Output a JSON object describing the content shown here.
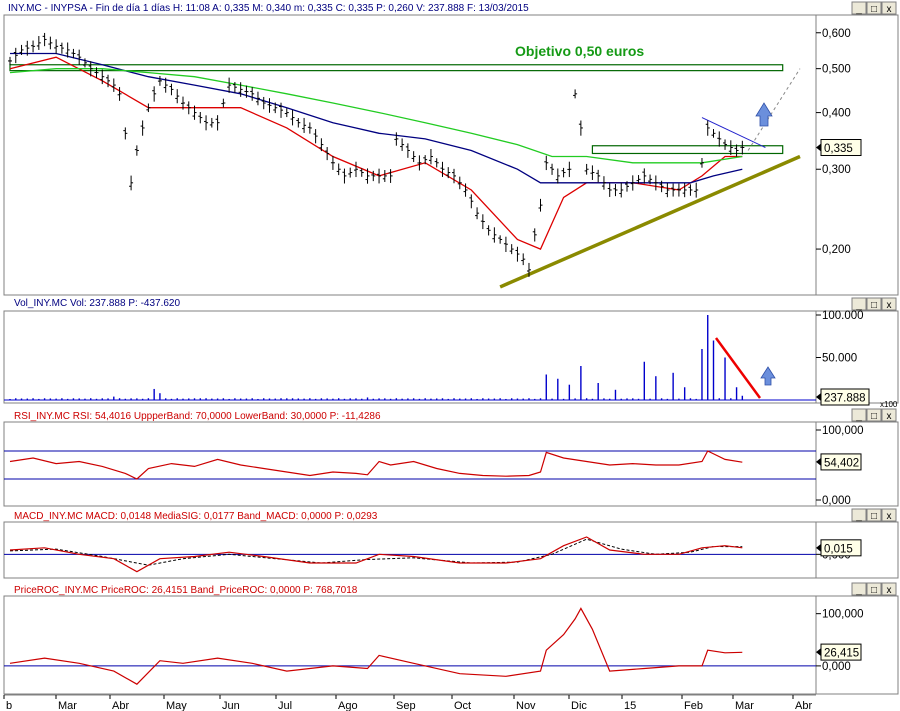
{
  "chart_data": {
    "type": "line",
    "window_controls": {
      "minimize": "_",
      "maximize": "□",
      "close": "x"
    },
    "months": [
      "b",
      "Mar",
      "Abr",
      "May",
      "Jun",
      "Jul",
      "Ago",
      "Sep",
      "Oct",
      "Nov",
      "Dic",
      "15",
      "Feb",
      "Mar",
      "Abr"
    ],
    "price_panel": {
      "header": "INY.MC - INYPSA - Fin de día 1 días H: 11:08  A: 0,335  M: 0,340  m: 0,335  C: 0,335  P: 0,260  V: 237.888  F: 13/03/2015",
      "scale": "log",
      "ylim": [
        0.16,
        0.65
      ],
      "y_ticks": [
        {
          "v": 0.6,
          "label": "0,600"
        },
        {
          "v": 0.5,
          "label": "0,500"
        },
        {
          "v": 0.4,
          "label": "0,400"
        },
        {
          "v": 0.3,
          "label": "0,300"
        },
        {
          "v": 0.2,
          "label": "0,200"
        }
      ],
      "last_value": {
        "v": 0.335,
        "label": "0,335"
      },
      "annotation": "Objetivo 0,50 euros",
      "close_points": [
        [
          0,
          0.52
        ],
        [
          2,
          0.55
        ],
        [
          4,
          0.56
        ],
        [
          6,
          0.58
        ],
        [
          8,
          0.56
        ],
        [
          10,
          0.55
        ],
        [
          12,
          0.53
        ],
        [
          14,
          0.5
        ],
        [
          16,
          0.48
        ],
        [
          18,
          0.46
        ],
        [
          19,
          0.44
        ],
        [
          20,
          0.36
        ],
        [
          21,
          0.28
        ],
        [
          22,
          0.33
        ],
        [
          24,
          0.41
        ],
        [
          26,
          0.47
        ],
        [
          28,
          0.45
        ],
        [
          30,
          0.42
        ],
        [
          32,
          0.4
        ],
        [
          34,
          0.38
        ],
        [
          36,
          0.38
        ],
        [
          38,
          0.46
        ],
        [
          40,
          0.45
        ],
        [
          42,
          0.44
        ],
        [
          44,
          0.42
        ],
        [
          46,
          0.41
        ],
        [
          48,
          0.4
        ],
        [
          50,
          0.38
        ],
        [
          52,
          0.37
        ],
        [
          54,
          0.34
        ],
        [
          56,
          0.31
        ],
        [
          58,
          0.29
        ],
        [
          60,
          0.3
        ],
        [
          62,
          0.29
        ],
        [
          64,
          0.29
        ],
        [
          66,
          0.29
        ],
        [
          67,
          0.35
        ],
        [
          69,
          0.33
        ],
        [
          71,
          0.31
        ],
        [
          73,
          0.32
        ],
        [
          75,
          0.3
        ],
        [
          77,
          0.29
        ],
        [
          79,
          0.27
        ],
        [
          81,
          0.24
        ],
        [
          83,
          0.22
        ],
        [
          85,
          0.21
        ],
        [
          87,
          0.2
        ],
        [
          89,
          0.19
        ],
        [
          90,
          0.18
        ],
        [
          92,
          0.25
        ],
        [
          93,
          0.31
        ],
        [
          95,
          0.29
        ],
        [
          97,
          0.3
        ],
        [
          98,
          0.44
        ],
        [
          99,
          0.37
        ],
        [
          100,
          0.3
        ],
        [
          102,
          0.29
        ],
        [
          104,
          0.27
        ],
        [
          106,
          0.27
        ],
        [
          108,
          0.28
        ],
        [
          110,
          0.29
        ],
        [
          112,
          0.28
        ],
        [
          114,
          0.27
        ],
        [
          116,
          0.27
        ],
        [
          118,
          0.27
        ],
        [
          119,
          0.27
        ],
        [
          120,
          0.31
        ],
        [
          121,
          0.37
        ],
        [
          122,
          0.36
        ],
        [
          124,
          0.34
        ],
        [
          126,
          0.33
        ],
        [
          127,
          0.335
        ]
      ],
      "moving_averages": [
        {
          "color": "#dd0000",
          "points": [
            [
              0,
              0.5
            ],
            [
              8,
              0.53
            ],
            [
              16,
              0.47
            ],
            [
              24,
              0.41
            ],
            [
              32,
              0.41
            ],
            [
              40,
              0.41
            ],
            [
              48,
              0.37
            ],
            [
              56,
              0.32
            ],
            [
              64,
              0.29
            ],
            [
              72,
              0.31
            ],
            [
              80,
              0.27
            ],
            [
              88,
              0.21
            ],
            [
              92,
              0.2
            ],
            [
              96,
              0.26
            ],
            [
              100,
              0.28
            ],
            [
              108,
              0.28
            ],
            [
              116,
              0.27
            ],
            [
              120,
              0.29
            ],
            [
              124,
              0.32
            ],
            [
              127,
              0.32
            ]
          ]
        },
        {
          "color": "#000080",
          "points": [
            [
              0,
              0.54
            ],
            [
              8,
              0.54
            ],
            [
              16,
              0.51
            ],
            [
              24,
              0.48
            ],
            [
              32,
              0.46
            ],
            [
              40,
              0.44
            ],
            [
              48,
              0.41
            ],
            [
              56,
              0.38
            ],
            [
              64,
              0.36
            ],
            [
              72,
              0.35
            ],
            [
              80,
              0.33
            ],
            [
              88,
              0.3
            ],
            [
              92,
              0.28
            ],
            [
              96,
              0.28
            ],
            [
              104,
              0.28
            ],
            [
              112,
              0.28
            ],
            [
              118,
              0.28
            ],
            [
              122,
              0.29
            ],
            [
              127,
              0.3
            ]
          ]
        },
        {
          "color": "#22cc22",
          "points": [
            [
              0,
              0.49
            ],
            [
              8,
              0.5
            ],
            [
              16,
              0.5
            ],
            [
              24,
              0.49
            ],
            [
              32,
              0.48
            ],
            [
              40,
              0.46
            ],
            [
              48,
              0.44
            ],
            [
              56,
              0.42
            ],
            [
              64,
              0.4
            ],
            [
              72,
              0.38
            ],
            [
              80,
              0.36
            ],
            [
              88,
              0.34
            ],
            [
              94,
              0.32
            ],
            [
              100,
              0.32
            ],
            [
              108,
              0.31
            ],
            [
              116,
              0.31
            ],
            [
              120,
              0.31
            ],
            [
              127,
              0.32
            ]
          ]
        }
      ],
      "trendline": {
        "color": "#8a8a00",
        "from": [
          85,
          0.165
        ],
        "to": [
          137,
          0.32
        ]
      },
      "resistance_box": {
        "from": [
          0,
          0.495
        ],
        "to": [
          134,
          0.51
        ]
      },
      "consolidation_box": {
        "from": [
          101,
          0.325
        ],
        "to": [
          134,
          0.338
        ]
      }
    },
    "volume_panel": {
      "header": "Vol_INY.MC  Vol: 237.888  P: -437.620",
      "ylim": [
        0,
        100000
      ],
      "y_ticks": [
        {
          "v": 100000,
          "label": "100.000"
        },
        {
          "v": 50000,
          "label": "50.000"
        }
      ],
      "last_value": {
        "v": 237888,
        "label": "237.888"
      },
      "multiplier": "x100",
      "spikes": [
        [
          18,
          4000
        ],
        [
          25,
          13000
        ],
        [
          26,
          8000
        ],
        [
          33,
          2000
        ],
        [
          48,
          2000
        ],
        [
          62,
          3000
        ],
        [
          70,
          2000
        ],
        [
          93,
          30000
        ],
        [
          95,
          25000
        ],
        [
          97,
          18000
        ],
        [
          99,
          40000
        ],
        [
          102,
          20000
        ],
        [
          105,
          12000
        ],
        [
          110,
          45000
        ],
        [
          112,
          28000
        ],
        [
          115,
          32000
        ],
        [
          117,
          15000
        ],
        [
          120,
          60000
        ],
        [
          121,
          100000
        ],
        [
          122,
          70000
        ],
        [
          124,
          50000
        ],
        [
          126,
          15000
        ],
        [
          127,
          5000
        ]
      ]
    },
    "rsi_panel": {
      "header": "RSI_INY.MC  RSI: 54,4016  UppperBand: 70,0000  LowerBand: 30,0000  P: -11,4286",
      "ylim": [
        0,
        100
      ],
      "y_ticks": [
        {
          "v": 100,
          "label": "100,000"
        },
        {
          "v": 0,
          "label": "0,000"
        }
      ],
      "upper_band": 70,
      "lower_band": 30,
      "last_value": {
        "v": 54.402,
        "label": "54,402"
      },
      "points": [
        [
          0,
          55
        ],
        [
          4,
          60
        ],
        [
          8,
          52
        ],
        [
          12,
          55
        ],
        [
          16,
          48
        ],
        [
          20,
          38
        ],
        [
          22,
          30
        ],
        [
          24,
          45
        ],
        [
          28,
          52
        ],
        [
          32,
          48
        ],
        [
          36,
          58
        ],
        [
          40,
          50
        ],
        [
          44,
          45
        ],
        [
          48,
          40
        ],
        [
          52,
          35
        ],
        [
          56,
          40
        ],
        [
          60,
          38
        ],
        [
          62,
          36
        ],
        [
          64,
          55
        ],
        [
          66,
          50
        ],
        [
          70,
          55
        ],
        [
          74,
          45
        ],
        [
          78,
          38
        ],
        [
          82,
          35
        ],
        [
          86,
          34
        ],
        [
          90,
          35
        ],
        [
          92,
          40
        ],
        [
          93,
          68
        ],
        [
          96,
          60
        ],
        [
          100,
          55
        ],
        [
          104,
          50
        ],
        [
          108,
          52
        ],
        [
          112,
          50
        ],
        [
          116,
          50
        ],
        [
          120,
          55
        ],
        [
          121,
          70
        ],
        [
          124,
          58
        ],
        [
          127,
          54
        ]
      ]
    },
    "macd_panel": {
      "header": "MACD_INY.MC  MACD: 0,0148  MediaSIG: 0,0177  Band_MACD: 0,0000  P: 0,0293",
      "ylim": [
        -0.05,
        0.07
      ],
      "y_ticks": [
        {
          "v": 0,
          "label": "0,000"
        }
      ],
      "band": 0,
      "last_value": {
        "v": 0.015,
        "label": "0,015"
      },
      "macd_points": [
        [
          0,
          0.01
        ],
        [
          6,
          0.015
        ],
        [
          12,
          0.0
        ],
        [
          18,
          -0.01
        ],
        [
          22,
          -0.04
        ],
        [
          26,
          -0.01
        ],
        [
          32,
          -0.005
        ],
        [
          38,
          0.005
        ],
        [
          44,
          -0.005
        ],
        [
          52,
          -0.02
        ],
        [
          60,
          -0.02
        ],
        [
          64,
          0.0
        ],
        [
          70,
          -0.005
        ],
        [
          78,
          -0.02
        ],
        [
          86,
          -0.02
        ],
        [
          92,
          -0.01
        ],
        [
          96,
          0.02
        ],
        [
          100,
          0.04
        ],
        [
          104,
          0.01
        ],
        [
          110,
          0.0
        ],
        [
          116,
          0.0
        ],
        [
          120,
          0.015
        ],
        [
          124,
          0.02
        ],
        [
          127,
          0.015
        ]
      ],
      "signal_points": [
        [
          0,
          0.008
        ],
        [
          8,
          0.012
        ],
        [
          16,
          -0.005
        ],
        [
          24,
          -0.025
        ],
        [
          30,
          -0.01
        ],
        [
          38,
          0.0
        ],
        [
          46,
          -0.01
        ],
        [
          54,
          -0.02
        ],
        [
          62,
          -0.012
        ],
        [
          70,
          -0.008
        ],
        [
          80,
          -0.02
        ],
        [
          88,
          -0.018
        ],
        [
          94,
          0.0
        ],
        [
          100,
          0.035
        ],
        [
          106,
          0.012
        ],
        [
          112,
          0.0
        ],
        [
          118,
          0.005
        ],
        [
          122,
          0.018
        ],
        [
          127,
          0.0177
        ]
      ]
    },
    "roc_panel": {
      "header": "PriceROC_INY.MC  PriceROC: 26,4151  Band_PriceROC: 0,0000  P: 768,7018",
      "ylim": [
        -50,
        130
      ],
      "y_ticks": [
        {
          "v": 100,
          "label": "100,000"
        },
        {
          "v": 0,
          "label": "0,000"
        }
      ],
      "band": 0,
      "last_value": {
        "v": 26.415,
        "label": "26,415"
      },
      "points": [
        [
          0,
          5
        ],
        [
          6,
          15
        ],
        [
          12,
          5
        ],
        [
          18,
          -10
        ],
        [
          22,
          -35
        ],
        [
          26,
          10
        ],
        [
          30,
          5
        ],
        [
          36,
          15
        ],
        [
          42,
          5
        ],
        [
          48,
          -10
        ],
        [
          56,
          0
        ],
        [
          62,
          -5
        ],
        [
          64,
          20
        ],
        [
          70,
          5
        ],
        [
          78,
          -15
        ],
        [
          86,
          -20
        ],
        [
          92,
          -10
        ],
        [
          93,
          30
        ],
        [
          96,
          60
        ],
        [
          98,
          90
        ],
        [
          99,
          110
        ],
        [
          101,
          70
        ],
        [
          104,
          -10
        ],
        [
          110,
          -5
        ],
        [
          116,
          0
        ],
        [
          120,
          0
        ],
        [
          121,
          30
        ],
        [
          124,
          25
        ],
        [
          127,
          26
        ]
      ]
    }
  }
}
